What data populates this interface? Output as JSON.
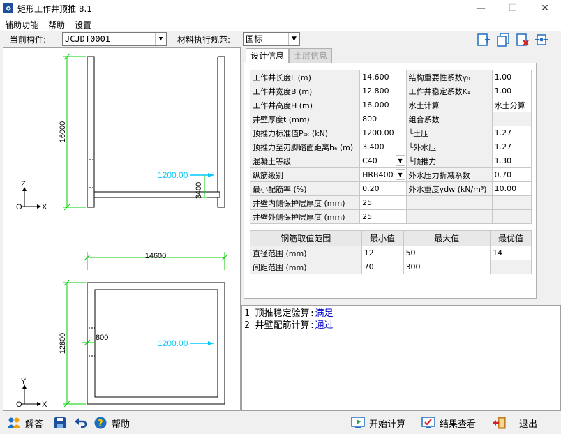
{
  "window": {
    "title": "矩形工作井顶推 8.1",
    "controls": [
      "—",
      "☐",
      "✕"
    ]
  },
  "menu": [
    "辅助功能",
    "帮助",
    "设置"
  ],
  "toolbar": {
    "component_label": "当前构件:",
    "component_value": "JCJDT0001",
    "spec_label": "材料执行规范:",
    "spec_value": "国标"
  },
  "drawing": {
    "dims": {
      "height": "16000",
      "length": "14600",
      "width": "12800",
      "top_force": "1200.00",
      "blade": "3400",
      "wall": "800",
      "plan_force": "1200.00"
    },
    "axes": {
      "z": "Z",
      "x": "X",
      "y": "Y",
      "x2": "X",
      "o": "O",
      "o2": "O"
    }
  },
  "tabs": [
    "设计信息",
    "土层信息"
  ],
  "params": [
    {
      "label": "工作井长度L (m)",
      "value": "14.600",
      "label2": "结构重要性系数γ₀",
      "value2": "1.00"
    },
    {
      "label": "工作井宽度B (m)",
      "value": "12.800",
      "label2": "工作井稳定系数K₁",
      "value2": "1.00"
    },
    {
      "label": "工作井高度H (m)",
      "value": "16.000",
      "label2": "水土计算",
      "value2": "水土分算"
    },
    {
      "label": "井壁厚度t (mm)",
      "value": "800",
      "label2": "组合系数",
      "value2": ""
    },
    {
      "label": "顶推力标准值Pₛₖ (kN)",
      "value": "1200.00",
      "label2": "└土压",
      "value2": "1.27"
    },
    {
      "label": "顶推力至刃脚踏面距离h₆ (m)",
      "value": "3.400",
      "label2": "└外水压",
      "value2": "1.27"
    },
    {
      "label": "混凝土等级",
      "value": "C40",
      "label2": "└顶推力",
      "value2": "1.30"
    },
    {
      "label": "纵筋级别",
      "value": "HRB400",
      "label2": "外水压力折减系数",
      "value2": "0.70"
    },
    {
      "label": "最小配筋率 (%)",
      "value": "0.20",
      "label2": "外水重度γdw (kN/m³)",
      "value2": "10.00"
    },
    {
      "label": "井壁内侧保护层厚度 (mm)",
      "value": "25",
      "label2": "",
      "value2": ""
    },
    {
      "label": "井壁外侧保护层厚度 (mm)",
      "value": "25",
      "label2": "",
      "value2": ""
    }
  ],
  "rebar": {
    "headers": [
      "钢筋取值范围",
      "最小值",
      "最大值",
      "最优值"
    ],
    "rows": [
      {
        "name": "直径范围 (mm)",
        "min": "12",
        "max": "50",
        "best": "14"
      },
      {
        "name": "间距范围 (mm)",
        "min": "70",
        "max": "300",
        "best": ""
      }
    ]
  },
  "log": [
    {
      "prefix": "1 顶推稳定验算:",
      "status": "满足"
    },
    {
      "prefix": "2 井壁配筋计算:",
      "status": "通过"
    }
  ],
  "bottom": {
    "answer": "解答",
    "help": "帮助",
    "start": "开始计算",
    "results": "结果查看",
    "exit": "退出"
  },
  "icons": [
    "app-icon",
    "new-icon",
    "copy-icon",
    "delete-icon",
    "settings-icon",
    "answer-icon",
    "save-icon",
    "undo-icon",
    "help-icon",
    "start-icon",
    "results-icon",
    "exit-icon"
  ],
  "colors": {
    "dimension": "#00cc00",
    "force": "#00c8ff",
    "status_ok": "#0000cc"
  }
}
